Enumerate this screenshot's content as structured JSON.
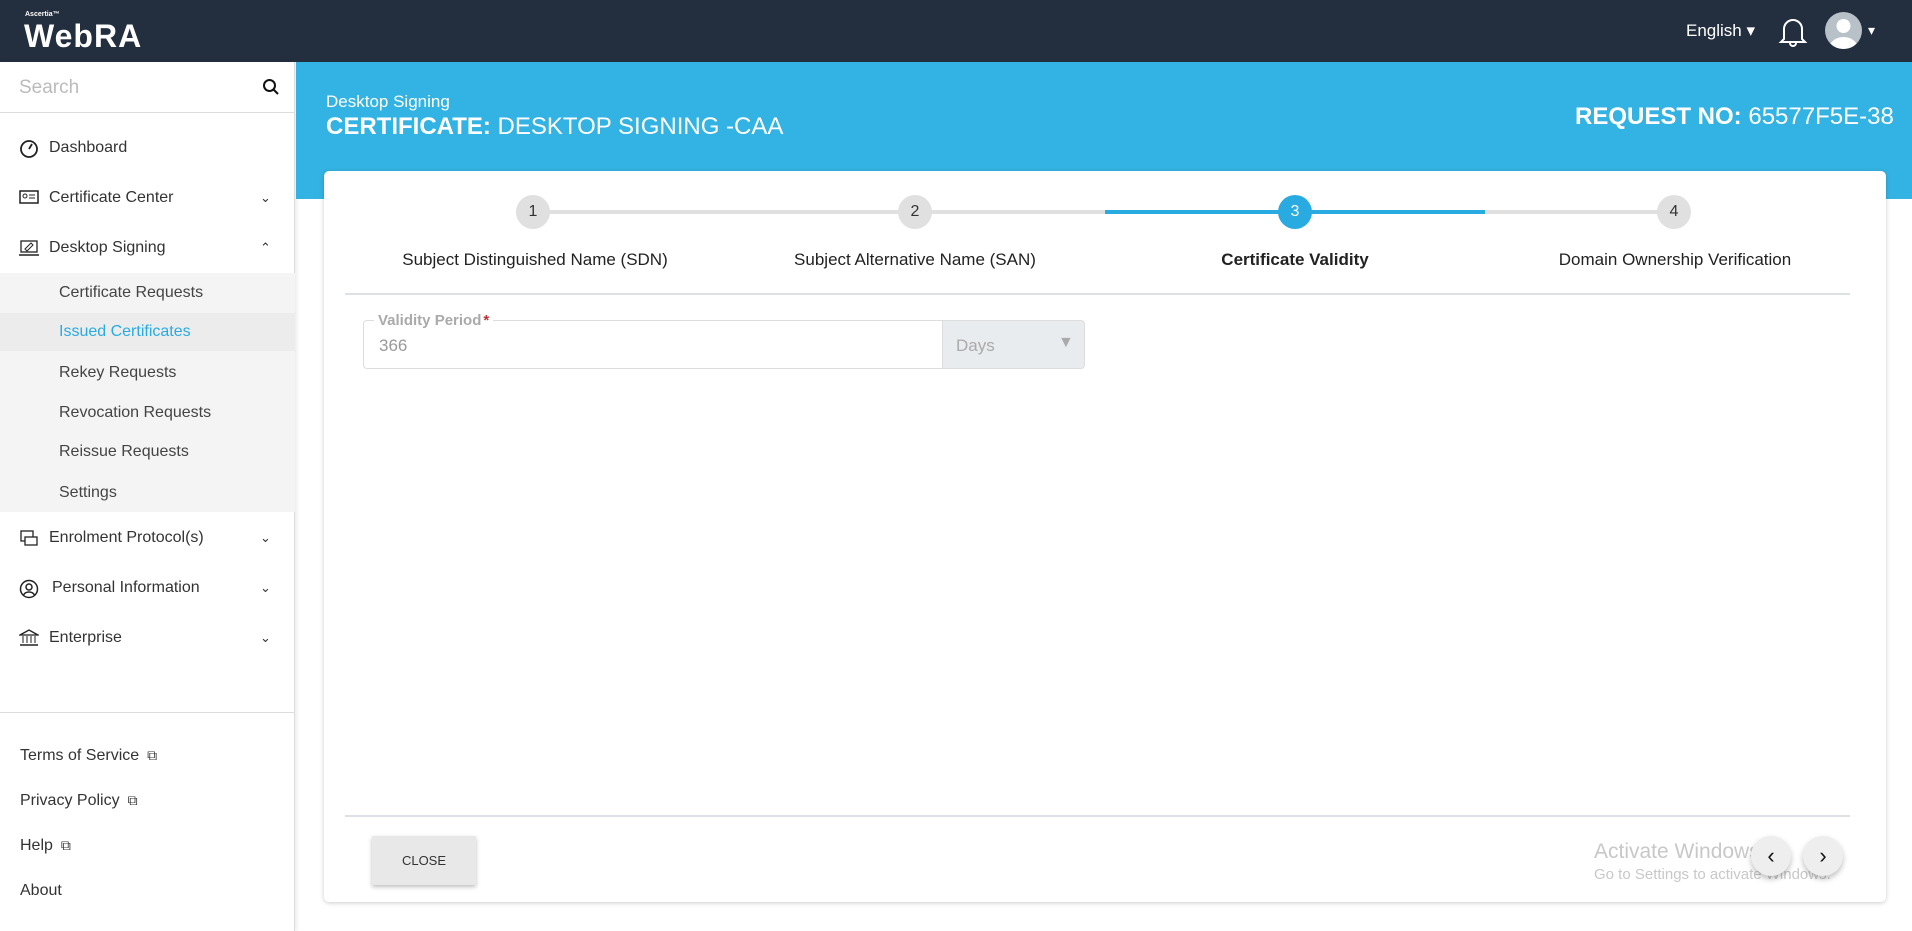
{
  "topbar": {
    "brand_small": "Ascertia™",
    "brand": "WebRA",
    "language": "English ▾",
    "avatar_caret": "▾"
  },
  "sidebar": {
    "search_placeholder": "Search",
    "items": [
      {
        "label": "Dashboard",
        "icon": "dashboard-icon"
      },
      {
        "label": "Certificate Center",
        "icon": "certificate-icon",
        "chevron": "⌄"
      },
      {
        "label": "Desktop Signing",
        "icon": "desktop-signing-icon",
        "chevron": "⌃"
      },
      {
        "label": "Enrolment Protocol(s)",
        "icon": "enrolment-icon",
        "chevron": "⌄"
      },
      {
        "label": "Personal Information",
        "icon": "user-icon",
        "chevron": "⌄"
      },
      {
        "label": "Enterprise",
        "icon": "bank-icon",
        "chevron": "⌄"
      }
    ],
    "submenu": [
      "Certificate Requests",
      "Issued Certificates",
      "Rekey Requests",
      "Revocation Requests",
      "Reissue Requests",
      "Settings"
    ],
    "footer": [
      "Terms of Service",
      "Privacy Policy",
      "Help",
      "About"
    ]
  },
  "banner": {
    "subtitle": "Desktop Signing",
    "title_label": "CERTIFICATE:",
    "title_value": "DESKTOP SIGNING -CAA",
    "req_label": "REQUEST NO:",
    "req_value": "65577F5E-38"
  },
  "steps": [
    {
      "num": "1",
      "label": "Subject Distinguished Name (SDN)"
    },
    {
      "num": "2",
      "label": "Subject Alternative Name (SAN)"
    },
    {
      "num": "3",
      "label": "Certificate Validity"
    },
    {
      "num": "4",
      "label": "Domain Ownership Verification"
    }
  ],
  "form": {
    "validity_label": "Validity Period",
    "required": "*",
    "validity_value": "366",
    "unit": "Days",
    "unit_caret": "▼"
  },
  "footer": {
    "close": "CLOSE",
    "prev": "‹",
    "next": "›"
  },
  "watermark": {
    "line1": "Activate Windows",
    "line2": "Go to Settings to activate Windows."
  },
  "colors": {
    "accent": "#33b3e3",
    "topbar": "#232e3f"
  }
}
